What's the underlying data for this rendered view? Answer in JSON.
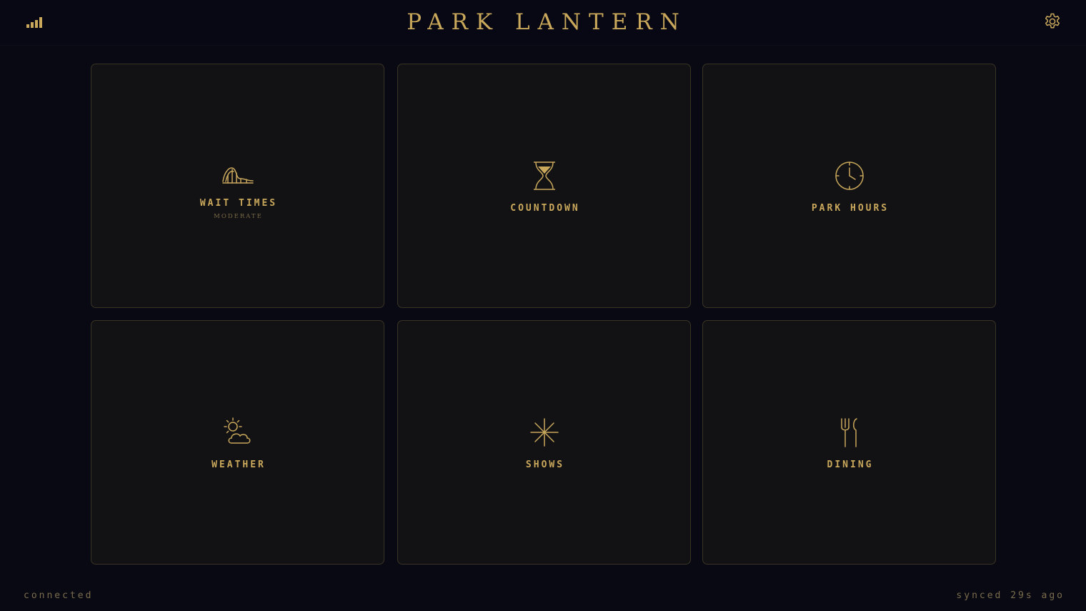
{
  "header": {
    "title": "PARK LANTERN",
    "signal_icon": "signal-bars-icon",
    "settings_icon": "gear-icon"
  },
  "tiles": [
    {
      "label": "WAIT TIMES",
      "sub": "MODERATE",
      "icon": "roller-coaster-icon"
    },
    {
      "label": "COUNTDOWN",
      "icon": "hourglass-icon"
    },
    {
      "label": "PARK HOURS",
      "icon": "clock-icon"
    },
    {
      "label": "WEATHER",
      "icon": "sun-cloud-icon"
    },
    {
      "label": "SHOWS",
      "icon": "sparkle-icon"
    },
    {
      "label": "DINING",
      "icon": "fork-spoon-icon"
    }
  ],
  "footer": {
    "status": "connected",
    "sync": "synced 29s ago"
  },
  "colors": {
    "background": "#080913",
    "accent_gold": "#c9a85c",
    "tile_bg": "#121214",
    "tile_border": "#3a3426"
  }
}
